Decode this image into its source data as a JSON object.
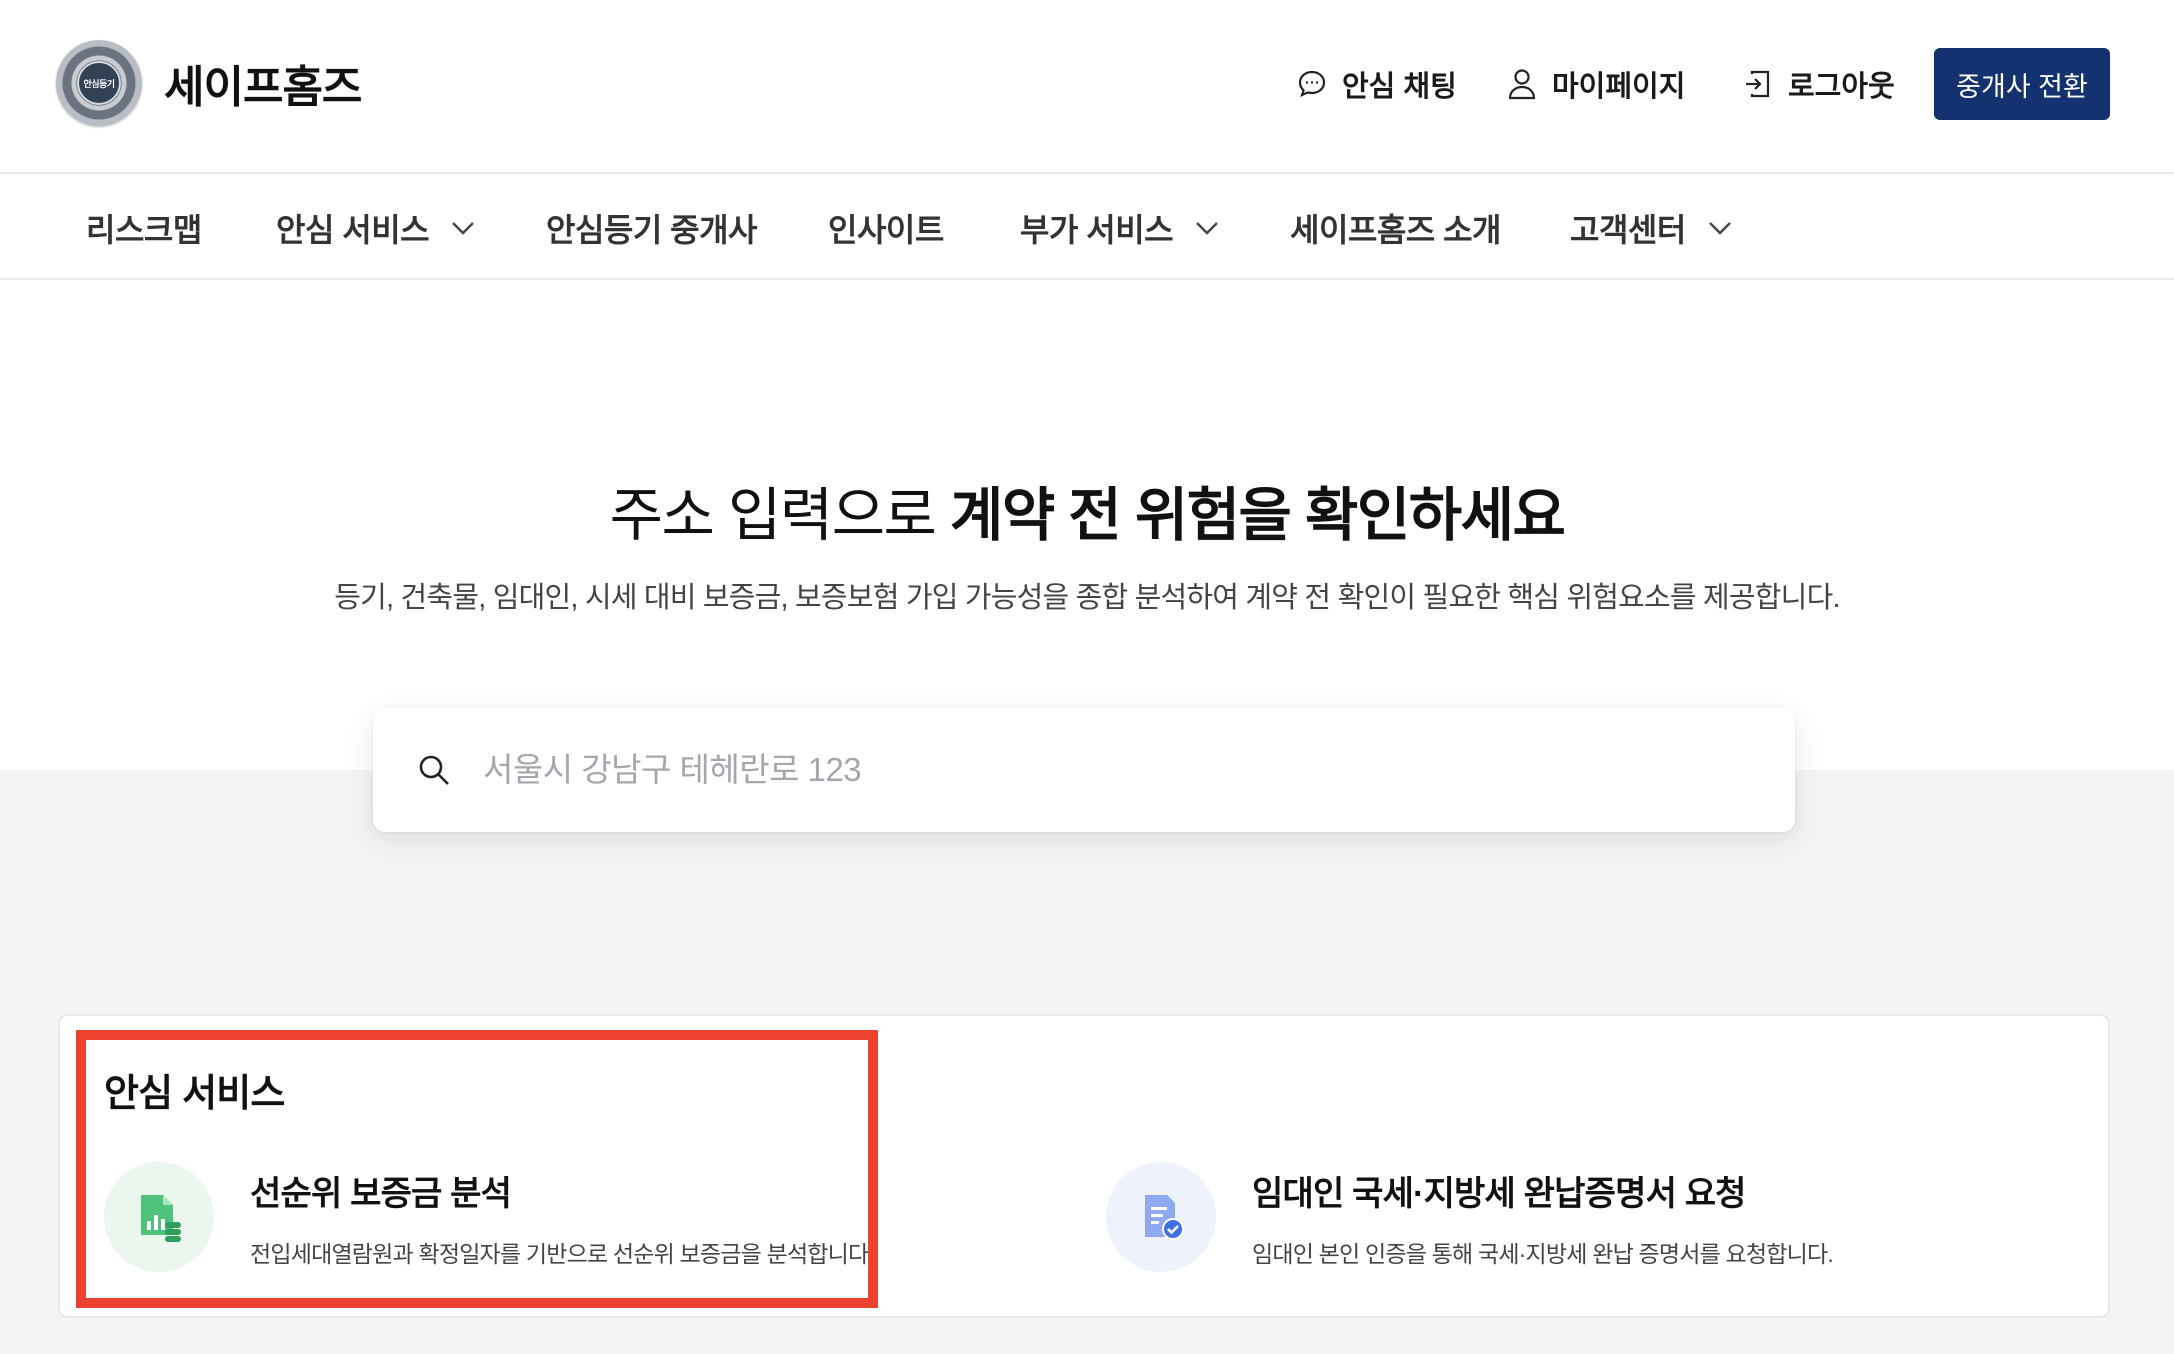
{
  "header": {
    "brand": "세이프홈즈",
    "seal_text": "안심등기",
    "chat_label": "안심 채팅",
    "mypage_label": "마이페이지",
    "logout_label": "로그아웃",
    "switch_label": "중개사 전환"
  },
  "nav": {
    "items": [
      {
        "label": "리스크맵",
        "dropdown": false
      },
      {
        "label": "안심 서비스",
        "dropdown": true
      },
      {
        "label": "안심등기 중개사",
        "dropdown": false
      },
      {
        "label": "인사이트",
        "dropdown": false
      },
      {
        "label": "부가 서비스",
        "dropdown": true
      },
      {
        "label": "세이프홈즈 소개",
        "dropdown": false
      },
      {
        "label": "고객센터",
        "dropdown": true
      }
    ]
  },
  "hero": {
    "title_light": "주소 입력으로 ",
    "title_bold": "계약 전 위험을 확인하세요",
    "subtitle": "등기, 건축물, 임대인, 시세 대비 보증금, 보증보험 가입 가능성을 종합 분석하여 계약 전 확인이 필요한 핵심 위험요소를 제공합니다."
  },
  "search": {
    "placeholder": "서울시 강남구 테헤란로 123",
    "value": ""
  },
  "services": {
    "title": "안심 서비스",
    "items": [
      {
        "name": "선순위 보증금 분석",
        "desc": "전입세대열람원과 확정일자를 기반으로 선순위 보증금을 분석합니다.",
        "icon": "chart-document-icon",
        "color": "#4cc27a"
      },
      {
        "name": "임대인 국세·지방세 완납증명서 요청",
        "desc": "임대인 본인 인증을 통해 국세·지방세 완납 증명서를 요청합니다.",
        "icon": "document-check-icon",
        "color": "#3f6fe0"
      }
    ]
  },
  "colors": {
    "primary": "#14326f",
    "highlight": "#ee4230",
    "lower_background": "#f3f4f6"
  }
}
